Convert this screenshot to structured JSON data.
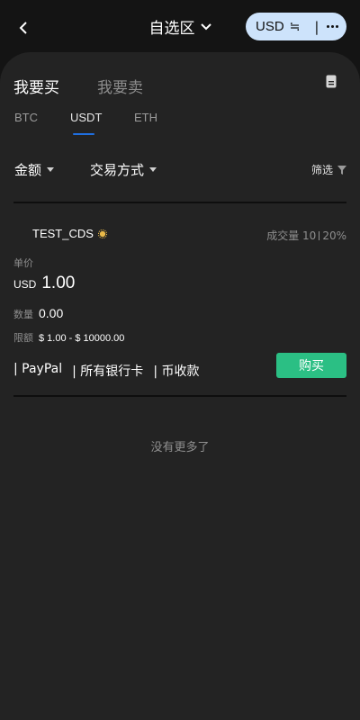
{
  "header": {
    "back_icon": "chevron-left-icon",
    "title": "自选区",
    "title_icon": "chevron-down-icon",
    "currency": "USD",
    "currency_symbol": "≒",
    "separator": "|",
    "more_icon": "more-dots-icon"
  },
  "trade_tabs": {
    "buy": "我要买",
    "sell": "我要卖",
    "doc_icon": "document-icon"
  },
  "coin_tabs": [
    {
      "label": "BTC",
      "active": false
    },
    {
      "label": "USDT",
      "active": true
    },
    {
      "label": "ETH",
      "active": false
    }
  ],
  "filters": {
    "amount": "金额",
    "method": "交易方式",
    "screen": "筛选",
    "screen_icon": "funnel-icon"
  },
  "listing": {
    "merchant": "TEST_CDS",
    "badge_icon": "gold-badge-icon",
    "volume_label": "成交量",
    "volume": "10",
    "rate": "20%",
    "price_label": "单价",
    "price_currency": "USD",
    "price": "1.00",
    "qty_label": "数量",
    "qty": "0.00",
    "limit_label": "限额",
    "limit": "$ 1.00 - $ 10000.00",
    "methods": [
      "| PayPal",
      "| 所有银行卡",
      "| 币收款"
    ],
    "buy_button": "购买"
  },
  "footer_text": "没有更多了",
  "colors": {
    "accent_blue": "#1f6fe0",
    "buy_green": "#2bbf84",
    "pill_bg": "#cde3fb"
  }
}
